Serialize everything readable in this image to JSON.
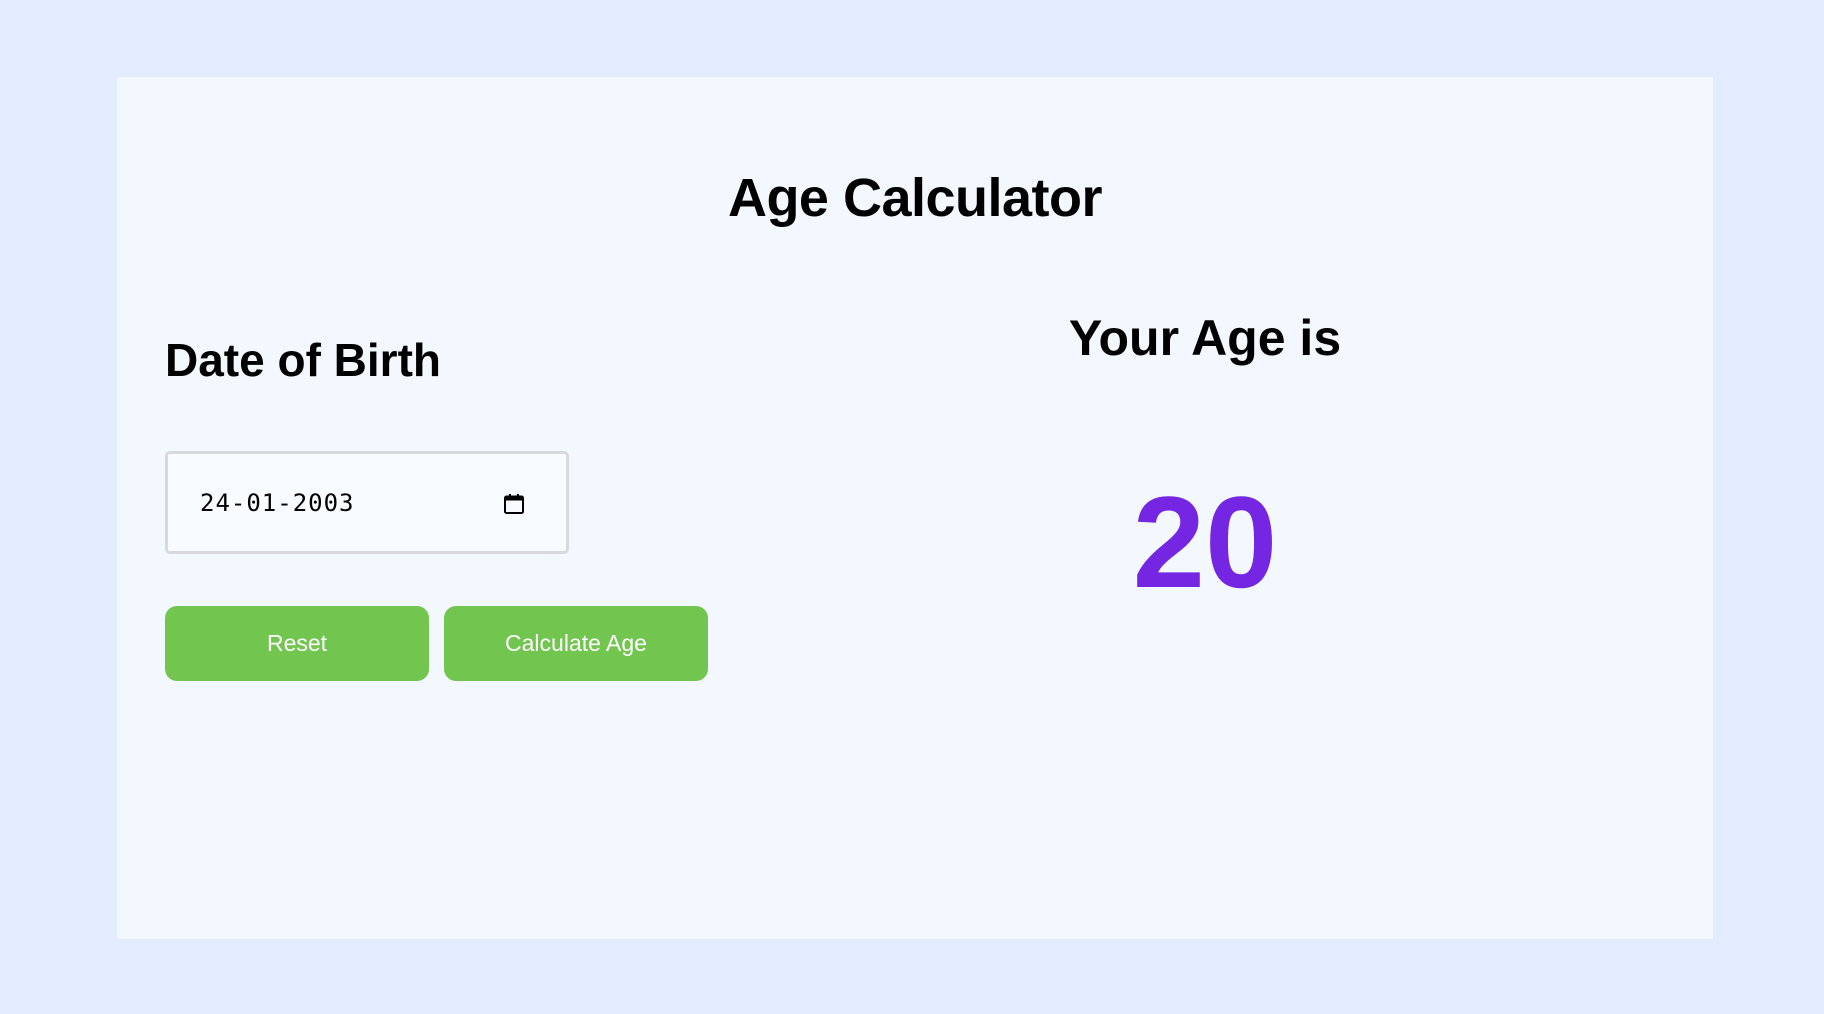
{
  "app": {
    "title": "Age Calculator"
  },
  "form": {
    "dob_label": "Date of Birth",
    "dob_value": "24-01-2003",
    "reset_label": "Reset",
    "calculate_label": "Calculate Age"
  },
  "result": {
    "label": "Your Age is",
    "age": "20"
  },
  "colors": {
    "page_background": "#e3ecfe",
    "card_background": "#f3f8fe",
    "button": "#72c650",
    "age_text": "#7526e3"
  },
  "icons": {
    "date_picker": "calendar-icon"
  }
}
